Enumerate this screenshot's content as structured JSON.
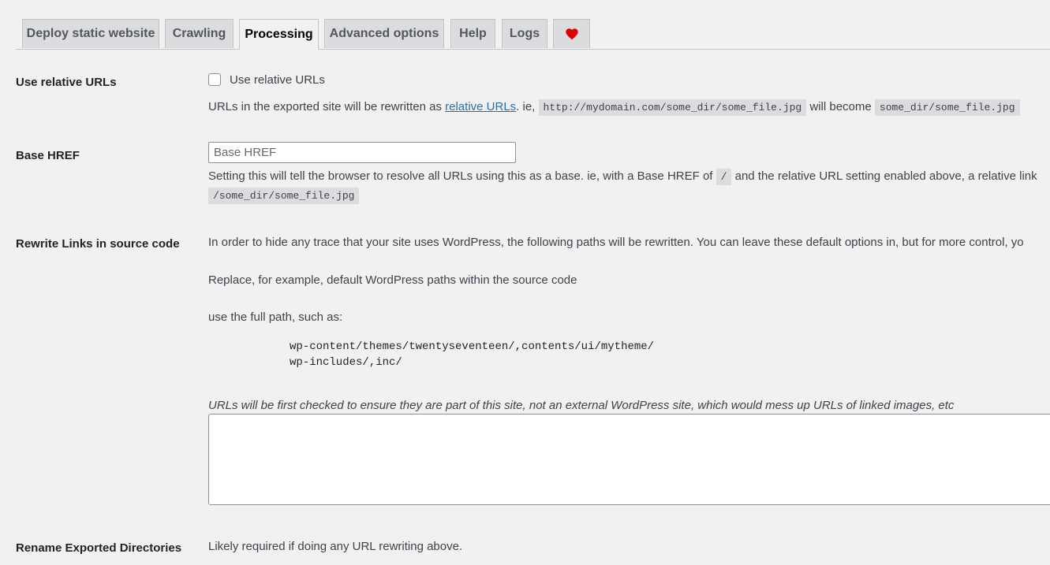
{
  "tabs": [
    {
      "label": "Deploy static website"
    },
    {
      "label": "Crawling"
    },
    {
      "label": "Processing",
      "active": true
    },
    {
      "label": "Advanced options"
    },
    {
      "label": "Help"
    },
    {
      "label": "Logs"
    },
    {
      "label": "",
      "icon": "heart-icon"
    }
  ],
  "relative_urls": {
    "label": "Use relative URLs",
    "checkbox_label": "Use relative URLs",
    "checked": false,
    "desc_prefix": "URLs in the exported site will be rewritten as ",
    "desc_link": "relative URLs",
    "desc_mid": ". ie, ",
    "example_from": "http://mydomain.com/some_dir/some_file.jpg",
    "desc_become": " will become ",
    "example_to": "some_dir/some_file.jpg"
  },
  "base_href": {
    "label": "Base HREF",
    "placeholder": "Base HREF",
    "desc_prefix": "Setting this will tell the browser to resolve all URLs using this as a base. ie, with a Base HREF of ",
    "example_base": "/",
    "desc_suffix": " and the relative URL setting enabled above, a relative link",
    "example_path": "/some_dir/some_file.jpg"
  },
  "rewrite_links": {
    "label": "Rewrite Links in source code",
    "intro": "In order to hide any trace that your site uses WordPress, the following paths will be rewritten. You can leave these default options in, but for more control, yo",
    "replace_text": "Replace, for example, default WordPress paths within the source code",
    "full_path_text": "use the full path, such as:",
    "example_line1": "wp-content/themes/twentyseventeen/,contents/ui/mytheme/",
    "example_line2": "wp-includes/,inc/",
    "note": "URLs will be first checked to ensure they are part of this site, not an external WordPress site, which would mess up URLs of linked images, etc",
    "textarea_value": ""
  },
  "rename_dirs": {
    "label": "Rename Exported Directories",
    "desc": "Likely required if doing any URL rewriting above."
  },
  "colors": {
    "heart": "#e00000",
    "link": "#2271b1"
  }
}
